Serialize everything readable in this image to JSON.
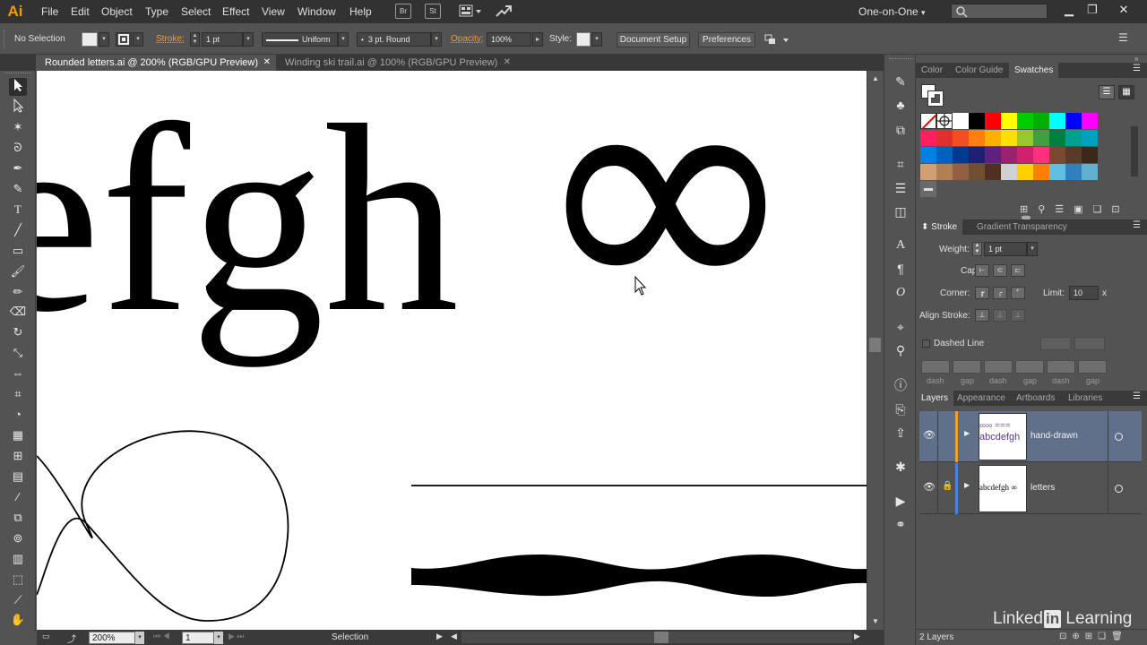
{
  "app": {
    "logo": "Ai"
  },
  "menu": [
    "File",
    "Edit",
    "Object",
    "Type",
    "Select",
    "Effect",
    "View",
    "Window",
    "Help"
  ],
  "titlebar": {
    "bridge": "Br",
    "stock": "St",
    "workspace": "One-on-One",
    "workspace_arrow": "▾"
  },
  "control": {
    "selection": "No Selection",
    "stroke_label": "Stroke:",
    "stroke_weight": "1 pt",
    "profile": "Uniform",
    "brush": "3 pt. Round",
    "opacity_label": "Opacity:",
    "opacity": "100%",
    "style_label": "Style:",
    "doc_setup": "Document Setup",
    "preferences": "Preferences"
  },
  "tabs": [
    {
      "label": "Rounded letters.ai @ 200% (RGB/GPU Preview)",
      "close": "✕"
    },
    {
      "label": "Winding ski trail.ai @ 100% (RGB/GPU Preview)",
      "close": "✕"
    }
  ],
  "artwork": {
    "letters": "efgh",
    "infinity": "∞"
  },
  "status": {
    "zoom": "200%",
    "artboard": "1",
    "tool": "Selection"
  },
  "swatch_panel": {
    "tabs": [
      "Color",
      "Color Guide",
      "Swatches"
    ],
    "colors": [
      "#ffffff",
      "#000000",
      "#ff0000",
      "#ffff00",
      "#00cc00",
      "#00b000",
      "#00ffff",
      "#0000ff",
      "#ff00ff",
      "#ff2060",
      "#e03030",
      "#f05020",
      "#ff8010",
      "#ffb000",
      "#ffe000",
      "#98c830",
      "#40a040",
      "#008040",
      "#00a090",
      "#00a0c0",
      "#0080e0",
      "#0060c0",
      "#003a90",
      "#202070",
      "#602080",
      "#9a2070",
      "#d02070",
      "#ff3080",
      "#7a4a30",
      "#5a3a28",
      "#3a2818",
      "#d0a070",
      "#b08050",
      "#906040",
      "#705030",
      "#503020",
      "#d0d0d0",
      "#ffd000",
      "#ff8000",
      "#60c0e0",
      "#3080c0",
      "#60b0d0",
      "#8080d0",
      "#c0a0d0"
    ]
  },
  "stroke_panel": {
    "tabs": [
      "Stroke",
      "Gradient",
      "Transparency"
    ],
    "weight_label": "Weight:",
    "weight": "1 pt",
    "cap_label": "Cap:",
    "corner_label": "Corner:",
    "limit_label": "Limit:",
    "limit": "10",
    "limit_unit": "x",
    "align_label": "Align Stroke:",
    "dashed_label": "Dashed Line",
    "dash_labels": [
      "dash",
      "gap",
      "dash",
      "gap",
      "dash",
      "gap"
    ]
  },
  "layers_panel": {
    "tabs": [
      "Layers",
      "Appearance",
      "Artboards",
      "Libraries"
    ],
    "layers": [
      {
        "name": "hand-drawn",
        "thumb_line1": "∞∞ ===",
        "thumb_line2": "abcdefgh",
        "color": "#f0a020"
      },
      {
        "name": "letters",
        "thumb_line1": "abcdefgh ∞",
        "thumb_line2": "",
        "color": "#4a7ee0"
      }
    ],
    "count": "2 Layers"
  },
  "watermark": {
    "text1": "Linked",
    "text2": "in",
    "text3": " Learning"
  }
}
